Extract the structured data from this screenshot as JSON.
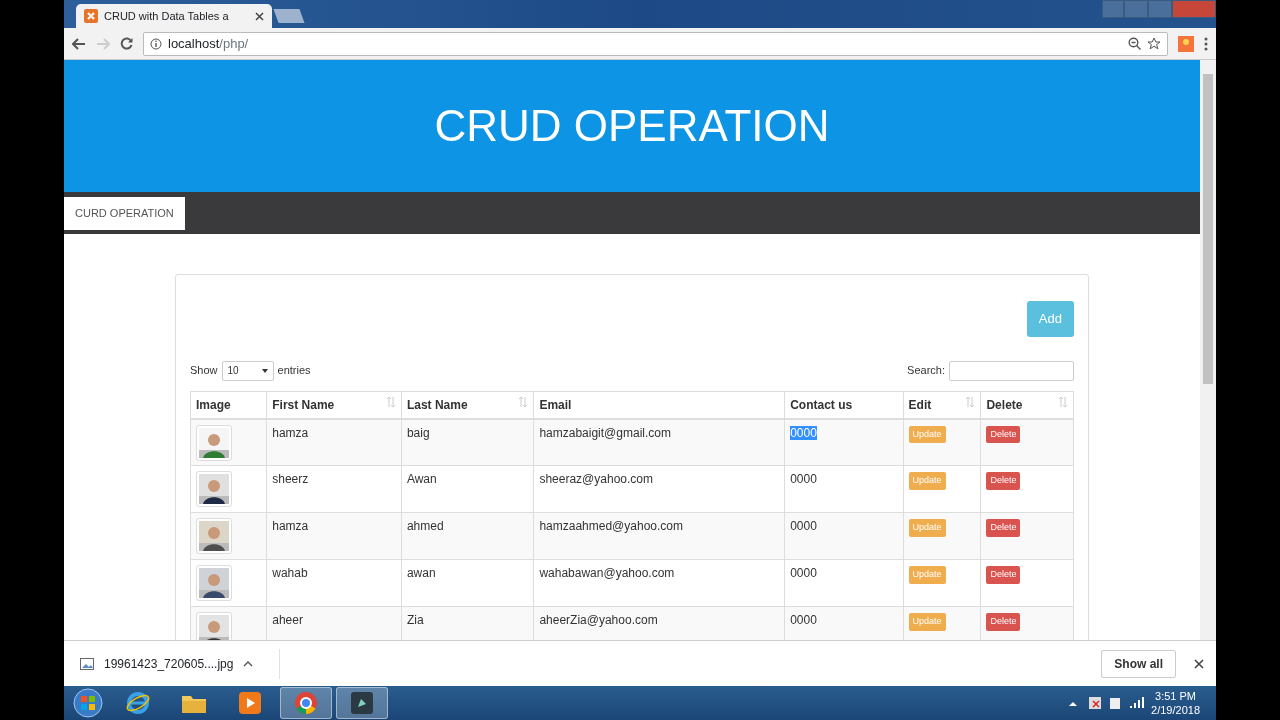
{
  "browser": {
    "tab_title": "CRUD with Data Tables a",
    "url_host": "localhost",
    "url_path": "/php/"
  },
  "page": {
    "banner_title": "CRUD OPERATION",
    "nav_items": [
      {
        "label": "CURD OPERATION",
        "selected": true
      }
    ],
    "add_button": "Add",
    "length": {
      "label_before": "Show",
      "value": "10",
      "label_after": "entries"
    },
    "search": {
      "label": "Search:"
    },
    "table": {
      "columns": [
        {
          "label": "Image",
          "sortable": false
        },
        {
          "label": "First Name",
          "sortable": true
        },
        {
          "label": "Last Name",
          "sortable": true
        },
        {
          "label": "Email",
          "sortable": false
        },
        {
          "label": "Contact us",
          "sortable": false
        },
        {
          "label": "Edit",
          "sortable": true
        },
        {
          "label": "Delete",
          "sortable": true
        }
      ],
      "rows": [
        {
          "first_name": "hamza",
          "last_name": "baig",
          "email": "hamzabaigit@gmail.com",
          "contact": "0000",
          "contact_highlighted": true,
          "edit": "Update",
          "delete": "Delete"
        },
        {
          "first_name": "sheerz",
          "last_name": "Awan",
          "email": "sheeraz@yahoo.com",
          "contact": "0000",
          "contact_highlighted": false,
          "edit": "Update",
          "delete": "Delete"
        },
        {
          "first_name": "hamza",
          "last_name": "ahmed",
          "email": "hamzaahmed@yahoo.com",
          "contact": "0000",
          "contact_highlighted": false,
          "edit": "Update",
          "delete": "Delete"
        },
        {
          "first_name": "wahab",
          "last_name": "awan",
          "email": "wahabawan@yahoo.com",
          "contact": "0000",
          "contact_highlighted": false,
          "edit": "Update",
          "delete": "Delete"
        },
        {
          "first_name": "aheer",
          "last_name": "Zia",
          "email": "aheerZia@yahoo.com",
          "contact": "0000",
          "contact_highlighted": false,
          "edit": "Update",
          "delete": "Delete"
        }
      ]
    }
  },
  "downloads": {
    "file": "19961423_720605....jpg",
    "show_all": "Show all"
  },
  "taskbar": {
    "apps": [
      {
        "kind": "ie",
        "selected": false
      },
      {
        "kind": "folder",
        "selected": false
      },
      {
        "kind": "media",
        "selected": false
      },
      {
        "kind": "chrome",
        "selected": true
      },
      {
        "kind": "editor",
        "selected": true
      }
    ],
    "time": "3:51 PM",
    "date": "2/19/2018"
  }
}
